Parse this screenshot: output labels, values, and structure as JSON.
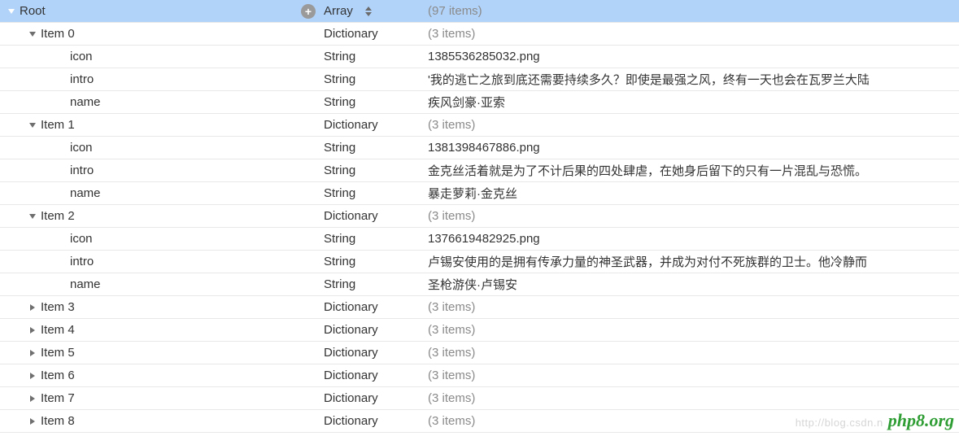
{
  "root": {
    "key": "Root",
    "type": "Array",
    "summary": "(97 items)"
  },
  "rows": [
    {
      "level": 1,
      "arrow": "down",
      "key": "Item 0",
      "type": "Dictionary",
      "valueMuted": "(3 items)"
    },
    {
      "level": 2,
      "key": "icon",
      "type": "String",
      "value": "1385536285032.png"
    },
    {
      "level": 2,
      "key": "intro",
      "type": "String",
      "value": "'我的逃亡之旅到底还需要持续多久？即使是最强之风，终有一天也会在瓦罗兰大陆"
    },
    {
      "level": 2,
      "key": "name",
      "type": "String",
      "value": "疾风剑豪·亚索"
    },
    {
      "level": 1,
      "arrow": "down",
      "key": "Item 1",
      "type": "Dictionary",
      "valueMuted": "(3 items)"
    },
    {
      "level": 2,
      "key": "icon",
      "type": "String",
      "value": "1381398467886.png"
    },
    {
      "level": 2,
      "key": "intro",
      "type": "String",
      "value": "金克丝活着就是为了不计后果的四处肆虐，在她身后留下的只有一片混乱与恐慌。"
    },
    {
      "level": 2,
      "key": "name",
      "type": "String",
      "value": "暴走萝莉·金克丝"
    },
    {
      "level": 1,
      "arrow": "down",
      "key": "Item 2",
      "type": "Dictionary",
      "valueMuted": "(3 items)"
    },
    {
      "level": 2,
      "key": "icon",
      "type": "String",
      "value": "1376619482925.png"
    },
    {
      "level": 2,
      "key": "intro",
      "type": "String",
      "value": "卢锡安使用的是拥有传承力量的神圣武器，并成为对付不死族群的卫士。他冷静而"
    },
    {
      "level": 2,
      "key": "name",
      "type": "String",
      "value": "圣枪游侠·卢锡安"
    },
    {
      "level": 1,
      "arrow": "right",
      "key": "Item 3",
      "type": "Dictionary",
      "valueMuted": "(3 items)"
    },
    {
      "level": 1,
      "arrow": "right",
      "key": "Item 4",
      "type": "Dictionary",
      "valueMuted": "(3 items)"
    },
    {
      "level": 1,
      "arrow": "right",
      "key": "Item 5",
      "type": "Dictionary",
      "valueMuted": "(3 items)"
    },
    {
      "level": 1,
      "arrow": "right",
      "key": "Item 6",
      "type": "Dictionary",
      "valueMuted": "(3 items)"
    },
    {
      "level": 1,
      "arrow": "right",
      "key": "Item 7",
      "type": "Dictionary",
      "valueMuted": "(3 items)"
    },
    {
      "level": 1,
      "arrow": "right",
      "key": "Item 8",
      "type": "Dictionary",
      "valueMuted": "(3 items)"
    }
  ],
  "watermark": {
    "faint": "http://blog.csdn.n",
    "brand": "php8.org"
  }
}
